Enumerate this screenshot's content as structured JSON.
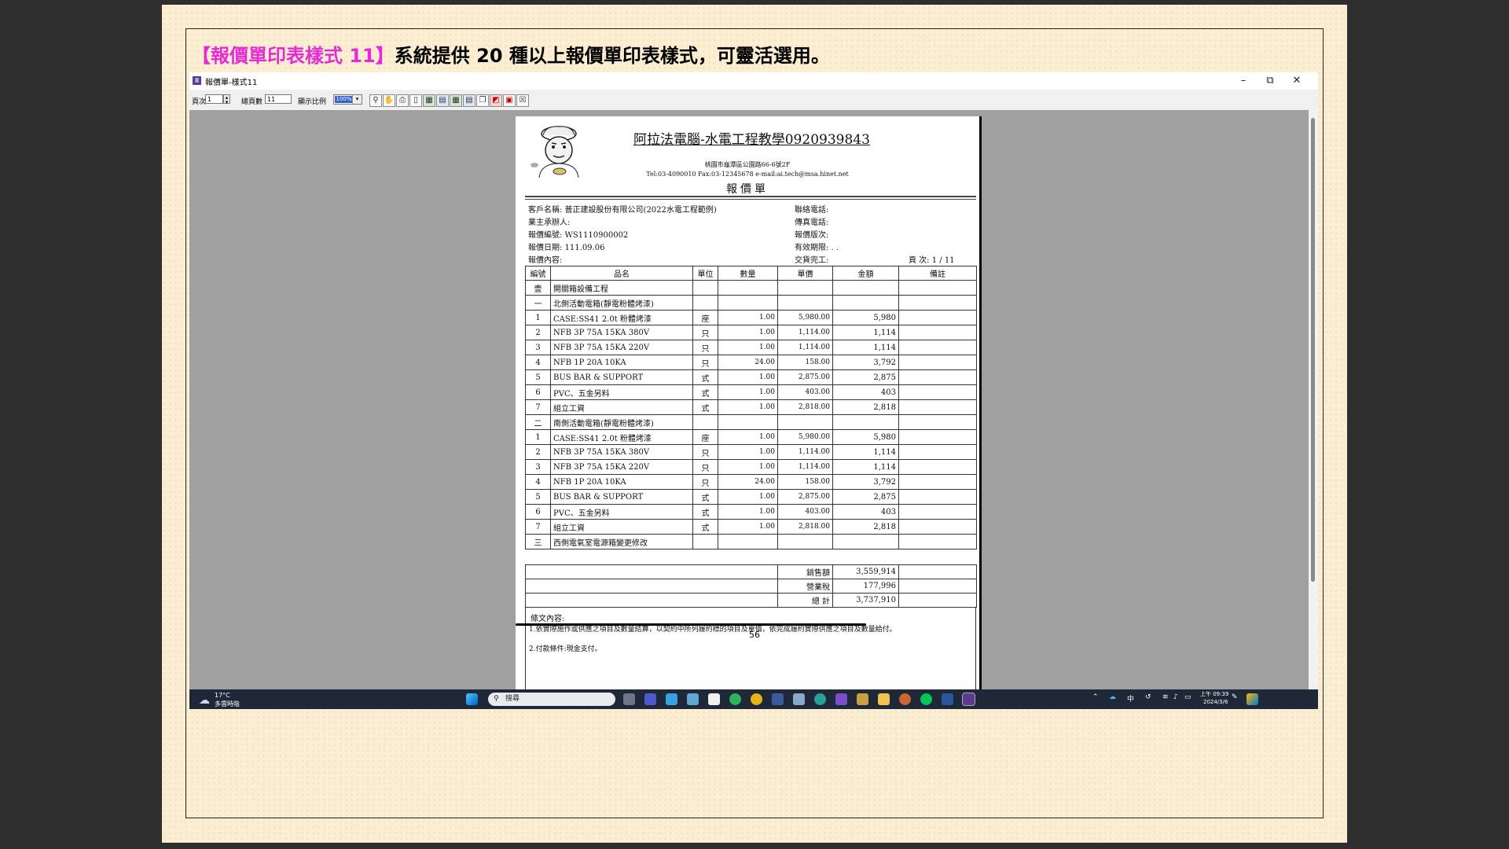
{
  "headline": {
    "bracket": "【報價單印表樣式 11】",
    "text": "系統提供 20 種以上報價單印表樣式，可靈活選用。"
  },
  "window": {
    "title": "報價單-樣式11"
  },
  "toolbar": {
    "page_label": "頁次",
    "page_value": "1",
    "total_label": "總頁數",
    "total_value": "11",
    "zoom_label": "顯示比例",
    "zoom_value": "100%"
  },
  "company": {
    "name": "阿拉法電腦-水電工程教學0920939843",
    "address": "桃園市龜潭區公園路66-6號2F",
    "contact": "Tel:03-4090010  Fax:03-12345678  e-mail:ai.tech@msa.hinet.net"
  },
  "doc_title": "報價單",
  "meta": {
    "customer": "客戶名稱: 普正建設股份有限公司(2022水電工程範例)",
    "contact_person": "業主承辦人:",
    "quote_no": "報價編號: WS1110900002",
    "quote_date": "報價日期: 111.09.06",
    "quote_content": "報價內容:",
    "phone": "聯絡電話:",
    "fax": "傳真電話:",
    "version": "報價版次:",
    "valid_date": "有效期限:   . .",
    "delivery": "交貨完工:",
    "page_info": "頁 次:   1  / 11"
  },
  "columns": [
    "編號",
    "品名",
    "單位",
    "數量",
    "單價",
    "金額",
    "備註"
  ],
  "rows": [
    {
      "no": "壹",
      "name": "開關箱設備工程",
      "unit": "",
      "qty": "",
      "price": "",
      "amount": "",
      "note": ""
    },
    {
      "no": "一",
      "name": "北側活動電箱(靜電粉體烤漆)",
      "unit": "",
      "qty": "",
      "price": "",
      "amount": "",
      "note": ""
    },
    {
      "no": "1",
      "name": "CASE:SS41 2.0t 粉體烤漆",
      "unit": "座",
      "qty": "1.00",
      "price": "5,980.00",
      "amount": "5,980",
      "note": ""
    },
    {
      "no": "2",
      "name": "NFB 3P 75A  15KA 380V",
      "unit": "只",
      "qty": "1.00",
      "price": "1,114.00",
      "amount": "1,114",
      "note": ""
    },
    {
      "no": "3",
      "name": "NFB 3P 75A  15KA 220V",
      "unit": "只",
      "qty": "1.00",
      "price": "1,114.00",
      "amount": "1,114",
      "note": ""
    },
    {
      "no": "4",
      "name": "NFB 1P 20A 10KA",
      "unit": "只",
      "qty": "24.00",
      "price": "158.00",
      "amount": "3,792",
      "note": ""
    },
    {
      "no": "5",
      "name": "BUS BAR & SUPPORT",
      "unit": "式",
      "qty": "1.00",
      "price": "2,875.00",
      "amount": "2,875",
      "note": ""
    },
    {
      "no": "6",
      "name": "PVC、五金另料",
      "unit": "式",
      "qty": "1.00",
      "price": "403.00",
      "amount": "403",
      "note": ""
    },
    {
      "no": "7",
      "name": "組立工資",
      "unit": "式",
      "qty": "1.00",
      "price": "2,818.00",
      "amount": "2,818",
      "note": ""
    },
    {
      "no": "二",
      "name": "南側活動電箱(靜電粉體烤漆)",
      "unit": "",
      "qty": "",
      "price": "",
      "amount": "",
      "note": ""
    },
    {
      "no": "1",
      "name": "CASE:SS41 2.0t 粉體烤漆",
      "unit": "座",
      "qty": "1.00",
      "price": "5,980.00",
      "amount": "5,980",
      "note": ""
    },
    {
      "no": "2",
      "name": "NFB 3P 75A  15KA 380V",
      "unit": "只",
      "qty": "1.00",
      "price": "1,114.00",
      "amount": "1,114",
      "note": ""
    },
    {
      "no": "3",
      "name": "NFB 3P 75A  15KA 220V",
      "unit": "只",
      "qty": "1.00",
      "price": "1,114.00",
      "amount": "1,114",
      "note": ""
    },
    {
      "no": "4",
      "name": "NFB 1P 20A 10KA",
      "unit": "只",
      "qty": "24.00",
      "price": "158.00",
      "amount": "3,792",
      "note": ""
    },
    {
      "no": "5",
      "name": "BUS BAR & SUPPORT",
      "unit": "式",
      "qty": "1.00",
      "price": "2,875.00",
      "amount": "2,875",
      "note": ""
    },
    {
      "no": "6",
      "name": "PVC、五金另料",
      "unit": "式",
      "qty": "1.00",
      "price": "403.00",
      "amount": "403",
      "note": ""
    },
    {
      "no": "7",
      "name": "組立工資",
      "unit": "式",
      "qty": "1.00",
      "price": "2,818.00",
      "amount": "2,818",
      "note": ""
    },
    {
      "no": "三",
      "name": "西側電氣室電源箱變更修改",
      "unit": "",
      "qty": "",
      "price": "",
      "amount": "",
      "note": ""
    }
  ],
  "totals": [
    {
      "label": "銷售額",
      "value": "3,559,914"
    },
    {
      "label": "營業稅",
      "value": "177,996"
    },
    {
      "label": "總   計",
      "value": "3,737,910"
    }
  ],
  "terms": {
    "title": "條文內容:",
    "line1": "1.依實際施作或供應之項目及數量結算，以契約中所列履約標的項目及單價，依完成履約實際供應之項目及數量給付。",
    "line2": "2.付款條件:現金支付。"
  },
  "taskbar": {
    "temp": "17°C",
    "weather": "多雲時陰",
    "search": "搜尋",
    "ime": "中",
    "time": "上午 09:39",
    "date": "2024/3/6"
  },
  "page_number": "56"
}
